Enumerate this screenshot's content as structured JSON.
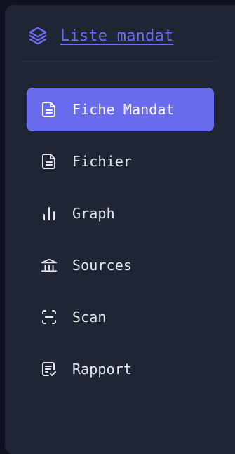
{
  "header": {
    "title": "Liste mandat",
    "icon": "layers-icon"
  },
  "nav": {
    "items": [
      {
        "label": "Fiche Mandat",
        "icon": "document-icon",
        "active": true
      },
      {
        "label": "Fichier",
        "icon": "document-icon",
        "active": false
      },
      {
        "label": "Graph",
        "icon": "bar-chart-icon",
        "active": false
      },
      {
        "label": "Sources",
        "icon": "building-icon",
        "active": false
      },
      {
        "label": "Scan",
        "icon": "scan-icon",
        "active": false
      },
      {
        "label": "Rapport",
        "icon": "report-icon",
        "active": false
      }
    ]
  },
  "colors": {
    "background": "#0d1120",
    "sidebar": "#1e2636",
    "accent": "#6a6cf0",
    "text": "#e6e8ee"
  }
}
